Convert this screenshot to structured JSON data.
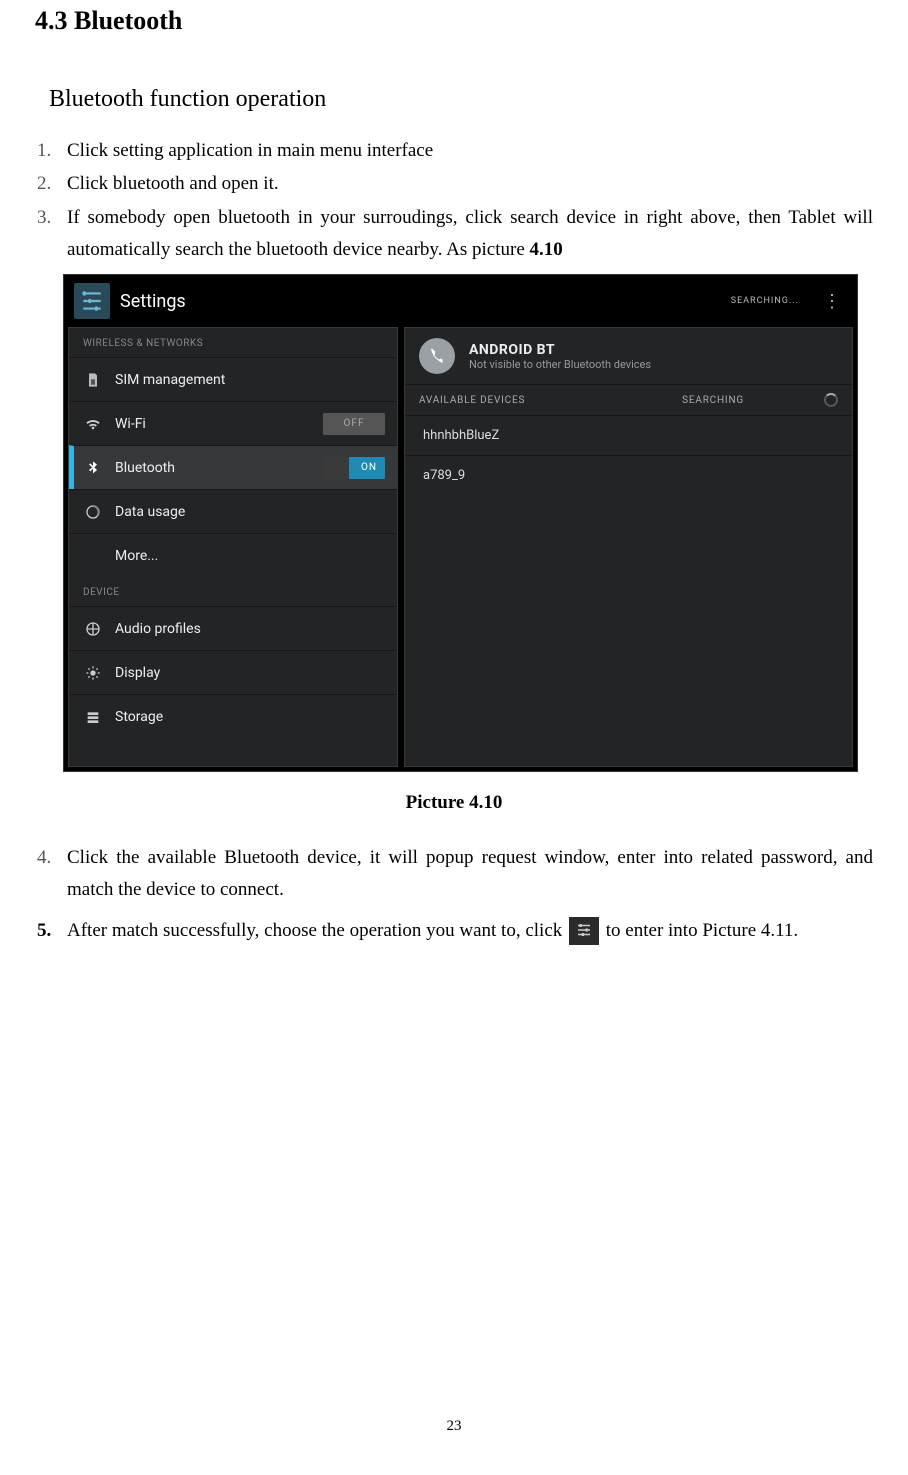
{
  "heading": "4.3   Bluetooth",
  "subheading": "Bluetooth function operation",
  "steps": [
    {
      "num": "1.",
      "text": "Click setting application in main menu interface"
    },
    {
      "num": "2.",
      "text": "Click bluetooth and open it."
    },
    {
      "num": "3.",
      "text_prefix": "If somebody open bluetooth in your surroudings, click search device in right above, then Tablet will automatically search the bluetooth device nearby. As picture ",
      "bold": "4.10"
    }
  ],
  "screenshot": {
    "title": "Settings",
    "status": "SEARCHING...",
    "sidebar": {
      "cat1": "WIRELESS & NETWORKS",
      "cat2": "DEVICE",
      "items": [
        {
          "label": "SIM management"
        },
        {
          "label": "Wi-Fi",
          "toggle": "OFF"
        },
        {
          "label": "Bluetooth",
          "toggle": "ON"
        },
        {
          "label": "Data usage"
        },
        {
          "label": "More..."
        }
      ],
      "device_items": [
        {
          "label": "Audio profiles"
        },
        {
          "label": "Display"
        },
        {
          "label": "Storage"
        }
      ]
    },
    "right": {
      "name": "ANDROID BT",
      "sub": "Not visible to other Bluetooth devices",
      "available": "AVAILABLE DEVICES",
      "searching": "SEARCHING",
      "devices": [
        "hhnhbhBlueZ",
        "a789_9"
      ]
    }
  },
  "caption": "Picture 4.10",
  "steps2": [
    {
      "num": "4.",
      "text": "Click the available Bluetooth device, it will popup request window, enter into related password, and match the device to connect."
    },
    {
      "num": "5.",
      "text_before": "After match successfully, choose the operation you want to, click ",
      "text_after": " to enter into Picture 4.11."
    }
  ],
  "page_number": "23"
}
